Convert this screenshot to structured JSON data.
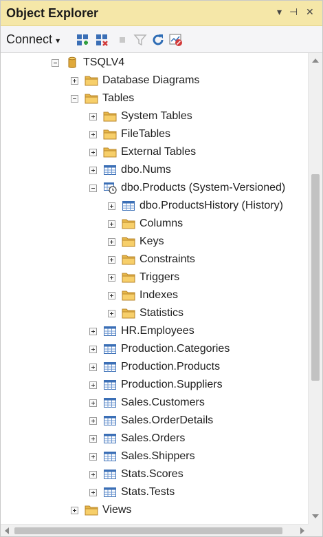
{
  "window": {
    "title": "Object Explorer",
    "title_bar_color": "#f5e7a8",
    "controls": [
      "pin-dropdown",
      "auto-hide-pin",
      "close"
    ]
  },
  "toolbar": {
    "connect_label": "Connect",
    "buttons": [
      "connect-object-explorer-icon",
      "disconnect-icon",
      "stop-icon",
      "filter-icon",
      "refresh-icon",
      "activity-monitor-icon"
    ]
  },
  "tree": {
    "database": "TSQLV4",
    "database_diagrams": "Database Diagrams",
    "tables": "Tables",
    "system_tables": "System Tables",
    "file_tables": "FileTables",
    "external_tables": "External Tables",
    "dbo_nums": "dbo.Nums",
    "dbo_products": "dbo.Products (System-Versioned)",
    "dbo_products_history": "dbo.ProductsHistory (History)",
    "columns": "Columns",
    "keys": "Keys",
    "constraints": "Constraints",
    "triggers": "Triggers",
    "indexes": "Indexes",
    "statistics": "Statistics",
    "hr_employees": "HR.Employees",
    "production_categories": "Production.Categories",
    "production_products": "Production.Products",
    "production_suppliers": "Production.Suppliers",
    "sales_customers": "Sales.Customers",
    "sales_orderdetails": "Sales.OrderDetails",
    "sales_orders": "Sales.Orders",
    "sales_shippers": "Sales.Shippers",
    "stats_scores": "Stats.Scores",
    "stats_tests": "Stats.Tests",
    "views": "Views"
  }
}
